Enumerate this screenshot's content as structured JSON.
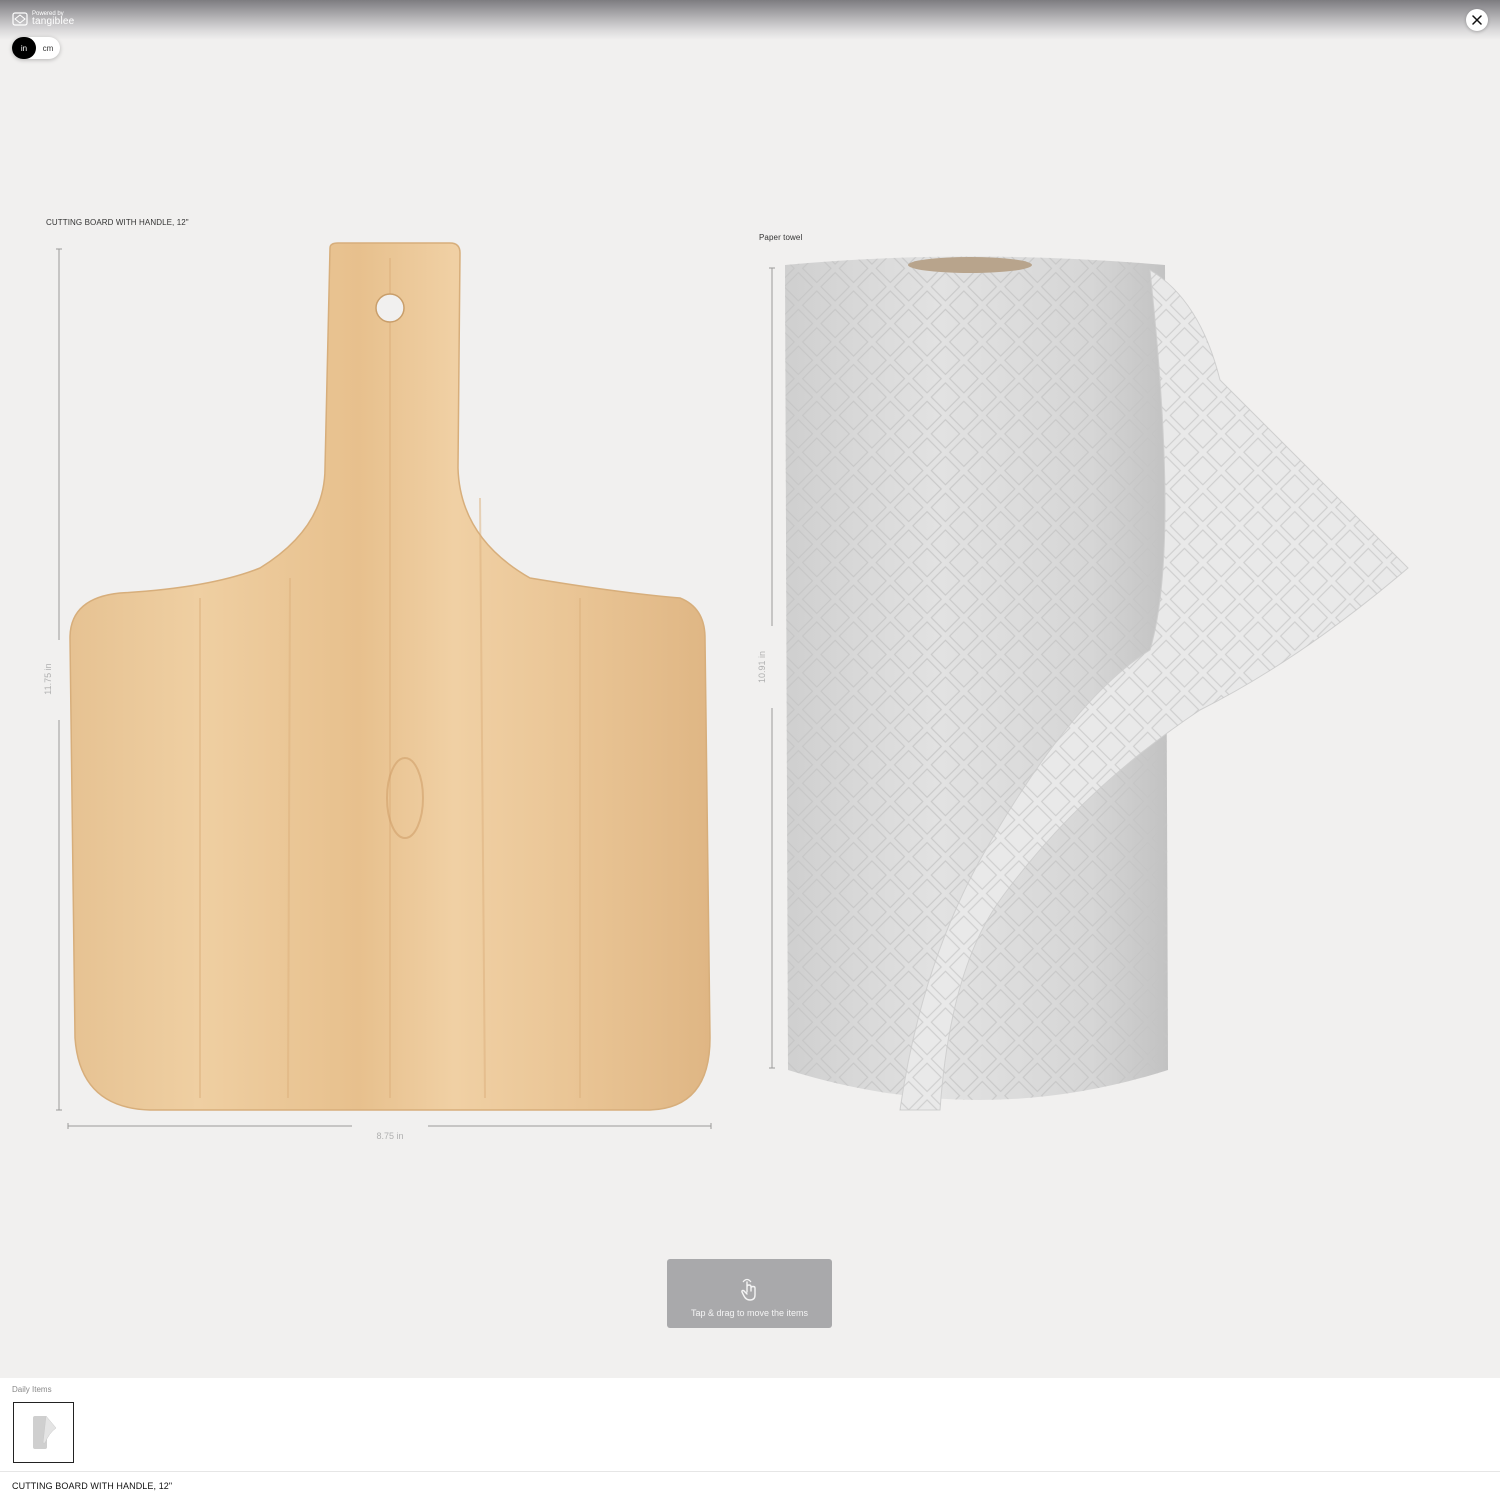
{
  "header": {
    "brand_small": "Powered by",
    "brand_name": "tangiblee",
    "brand_icon": "tangiblee-logo-icon",
    "close_icon": "close-icon"
  },
  "unit_toggle": {
    "options": [
      "in",
      "cm"
    ],
    "selected": "in"
  },
  "items": [
    {
      "label": "CUTTING BOARD WITH HANDLE, 12\"",
      "height_dim": "11.75 in",
      "width_dim": "8.75 in",
      "icon": "cutting-board-image"
    },
    {
      "label": "Paper towel",
      "height_dim": "10.91 in",
      "icon": "paper-towel-image"
    }
  ],
  "hint": {
    "icon": "tap-drag-hand-icon",
    "text": "Tap & drag to move the items"
  },
  "bottom_panel": {
    "category_title": "Daily Items",
    "thumbnail_icon": "paper-towel-thumbnail",
    "selected_name": "CUTTING BOARD WITH HANDLE, 12\""
  },
  "colors": {
    "background": "#f1f0ef",
    "wood": "#e8c596",
    "paper": "#d9d9d9",
    "hint_bg": "#a9a9ab"
  }
}
